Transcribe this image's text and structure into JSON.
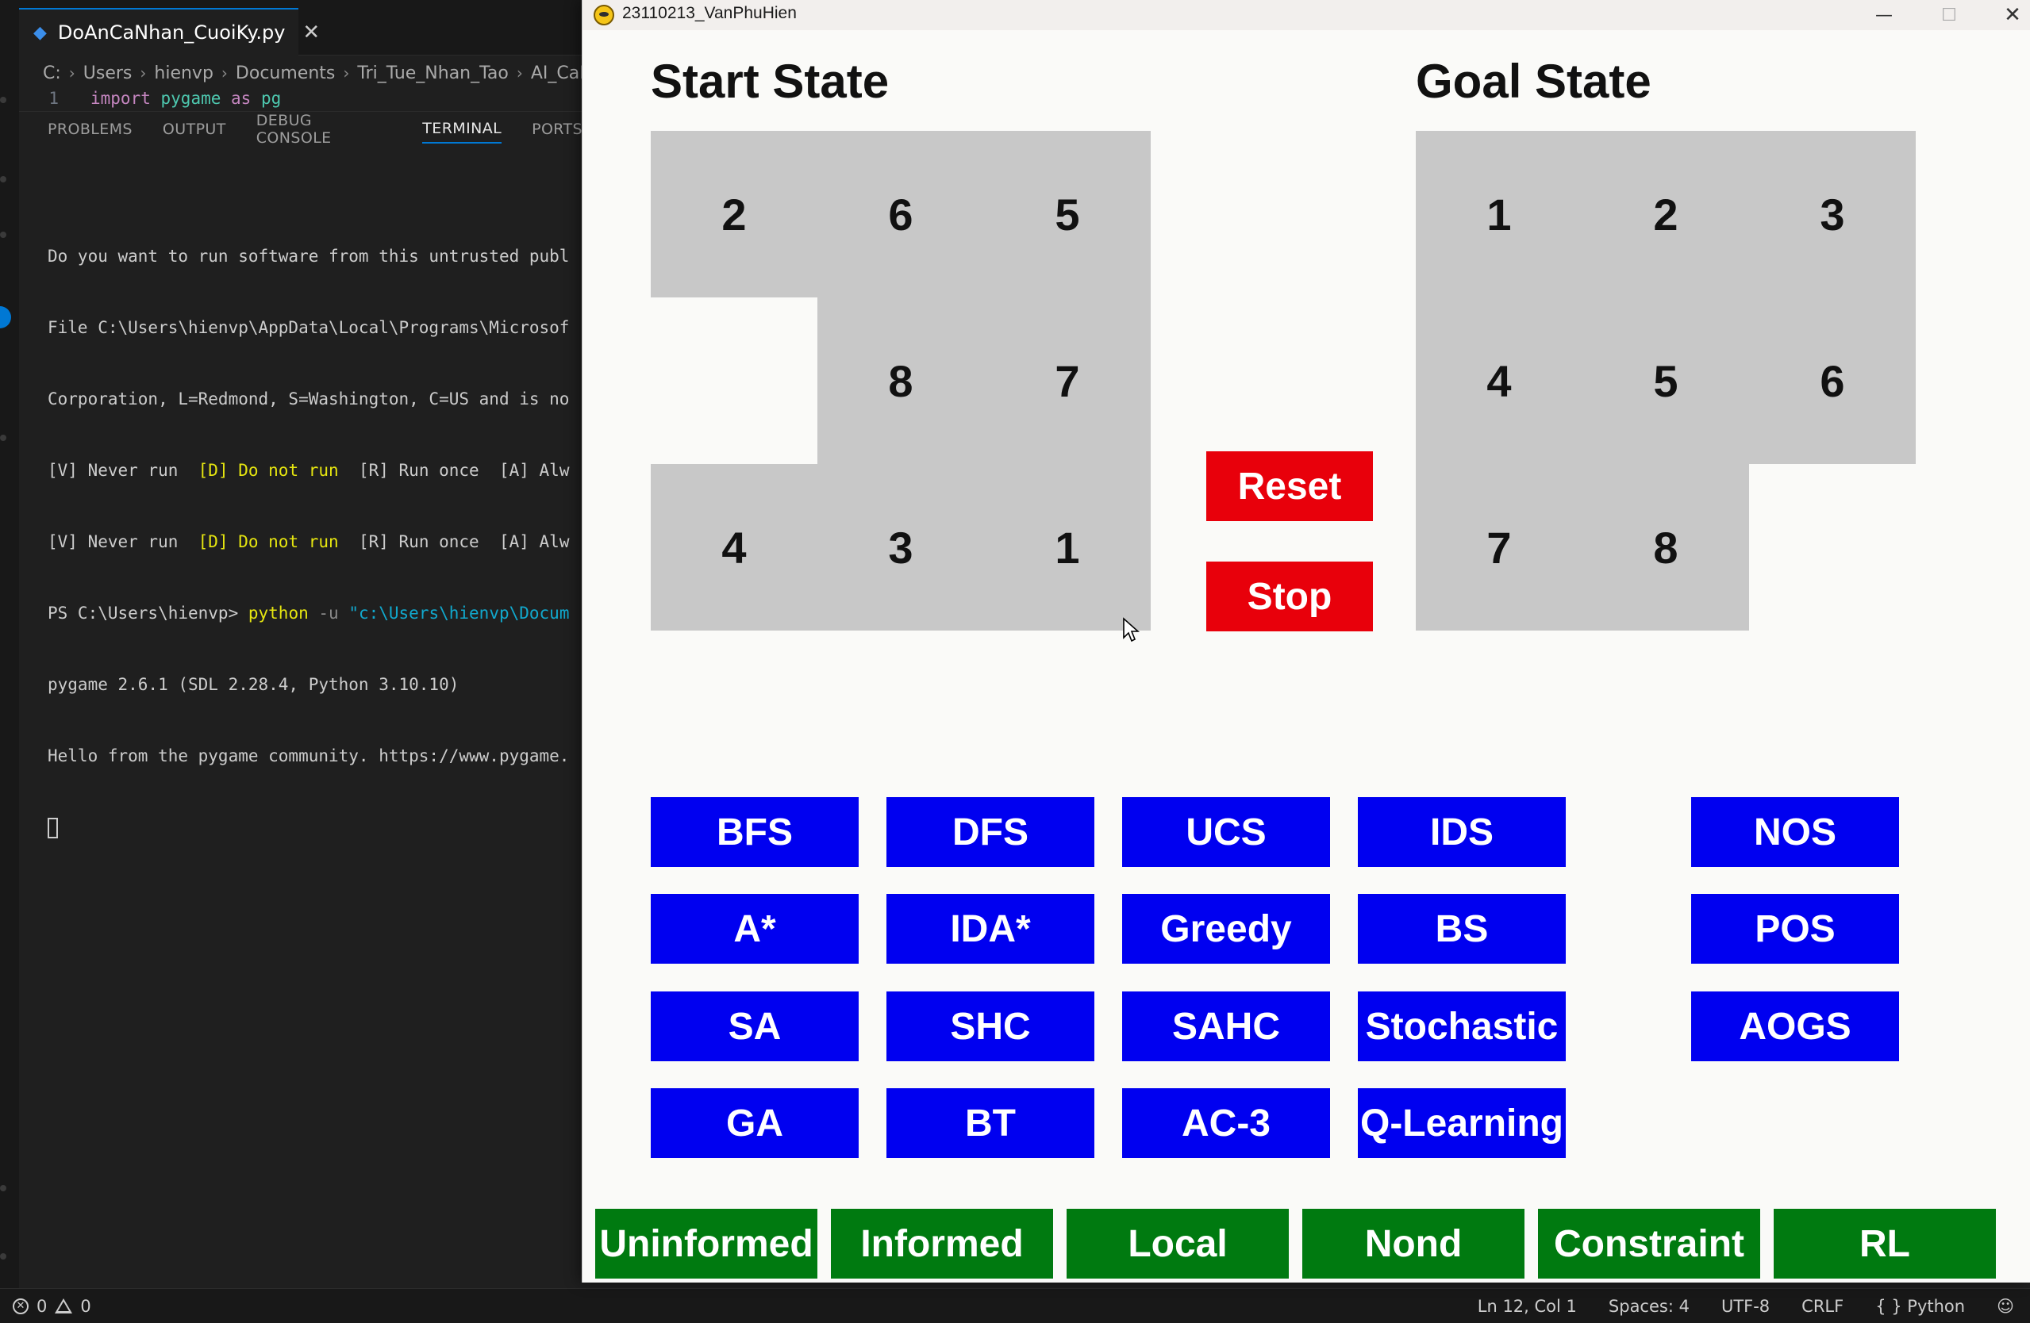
{
  "vscode": {
    "tab": {
      "filename": "DoAnCaNhan_CuoiKy.py",
      "close": "✕"
    },
    "breadcrumb": [
      "C:",
      "Users",
      "hienvp",
      "Documents",
      "Tri_Tue_Nhan_Tao",
      "AI_CaNhan"
    ],
    "code_line": {
      "number": "1",
      "keyword": "import",
      "module": "pygame",
      "as_kw": "as",
      "alias": "pg"
    },
    "panel_tabs": [
      "PROBLEMS",
      "OUTPUT",
      "DEBUG CONSOLE",
      "TERMINAL",
      "PORTS"
    ],
    "terminal": {
      "line1": "Do you want to run software from this untrusted publ",
      "line2": "File C:\\Users\\hienvp\\AppData\\Local\\Programs\\Microsof",
      "line3": "Corporation, L=Redmond, S=Washington, C=US and is no",
      "line4a": "[V] Never run  ",
      "line4b": "[D] Do not run",
      "line4c": "  [R] Run once  [A] Alw",
      "line5a": "[V] Never run  ",
      "line5b": "[D] Do not run",
      "line5c": "  [R] Run once  [A] Alw",
      "line6a": "PS C:\\Users\\hienvp> ",
      "line6b": "python",
      "line6c": " -u ",
      "line6d": "\"c:\\Users\\hienvp\\Docum",
      "line7": "pygame 2.6.1 (SDL 2.28.4, Python 3.10.10)",
      "line8": "Hello from the pygame community. https://www.pygame."
    },
    "status": {
      "errors": "0",
      "warnings": "0",
      "position": "Ln 12, Col 1",
      "spaces": "Spaces: 4",
      "encoding": "UTF-8",
      "eol": "CRLF",
      "language": "{ } Python"
    }
  },
  "window": {
    "title": "23110213_VanPhuHien",
    "minimize": "—",
    "maximize": "☐",
    "close": "✕"
  },
  "puzzle": {
    "start_title": "Start State",
    "goal_title": "Goal State",
    "start_state": [
      [
        "2",
        "6",
        "5"
      ],
      [
        "",
        "8",
        "7"
      ],
      [
        "4",
        "3",
        "1"
      ]
    ],
    "goal_state": [
      [
        "1",
        "2",
        "3"
      ],
      [
        "4",
        "5",
        "6"
      ],
      [
        "7",
        "8",
        ""
      ]
    ]
  },
  "controls": {
    "reset": "Reset",
    "stop": "Stop"
  },
  "algorithms": [
    [
      "BFS",
      "DFS",
      "UCS",
      "IDS"
    ],
    [
      "A*",
      "IDA*",
      "Greedy",
      "BS"
    ],
    [
      "SA",
      "SHC",
      "SAHC",
      "Stochastic"
    ],
    [
      "GA",
      "BT",
      "AC-3",
      "Q-Learning"
    ]
  ],
  "nondeterministic": [
    "NOS",
    "POS",
    "AOGS"
  ],
  "categories": [
    "Uninformed",
    "Informed",
    "Local",
    "Nond",
    "Constraint",
    "RL"
  ],
  "colors": {
    "algo_button": "#0000f0",
    "category_button": "#007a10",
    "control_button": "#e8000b",
    "tile": "#c8c8c8"
  }
}
